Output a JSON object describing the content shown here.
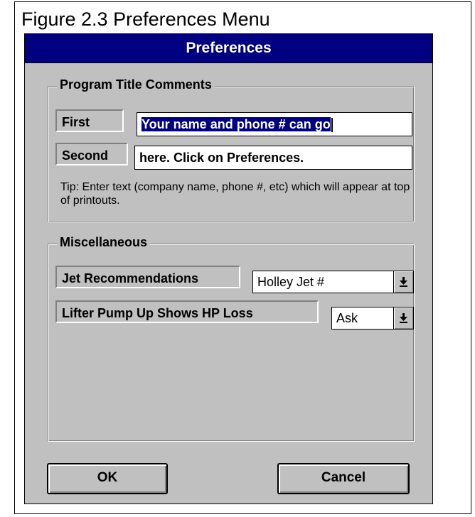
{
  "figure": {
    "caption": "Figure 2.3  Preferences Menu"
  },
  "dialog": {
    "title": "Preferences",
    "title_bar_color": "#000080",
    "face_color": "#c0c0c0",
    "program_title_group": {
      "label": "Program Title Comments",
      "first_label": "First",
      "first_value": "Your name and phone # can go",
      "first_selected": true,
      "second_label": "Second",
      "second_value": "here.  Click on Preferences.",
      "tip": "Tip:  Enter text (company name, phone #, etc) which will appear at top of printouts."
    },
    "misc_group": {
      "label": "Miscellaneous",
      "jet_label": "Jet Recommendations",
      "jet_value": "Holley Jet #",
      "lifter_label": "Lifter Pump Up Shows HP Loss",
      "lifter_value": "Ask"
    },
    "buttons": {
      "ok": "OK",
      "cancel": "Cancel"
    },
    "icons": {
      "dropdown": "dropdown-arrow-icon"
    }
  }
}
